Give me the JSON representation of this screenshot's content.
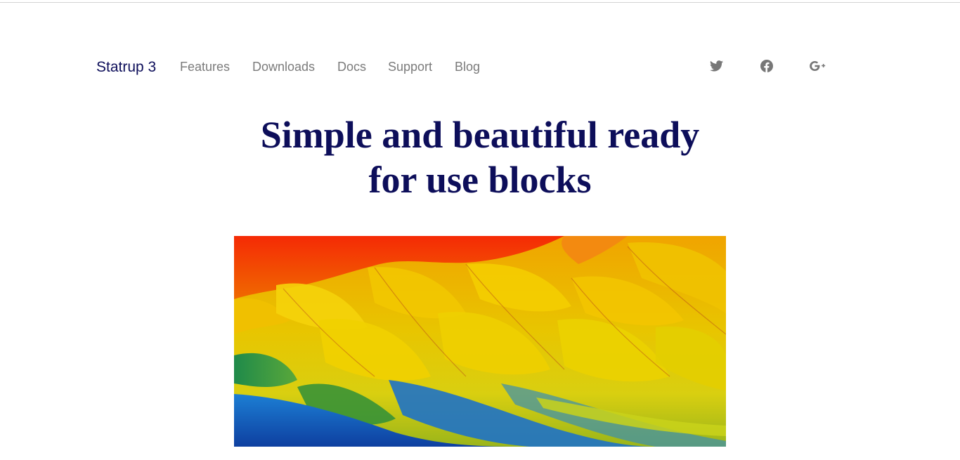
{
  "nav": {
    "brand": "Statrup 3",
    "links": [
      {
        "label": "Features"
      },
      {
        "label": "Downloads"
      },
      {
        "label": "Docs"
      },
      {
        "label": "Support"
      },
      {
        "label": "Blog"
      }
    ],
    "social": [
      {
        "icon": "twitter-icon"
      },
      {
        "icon": "facebook-icon"
      },
      {
        "icon": "google-plus-icon"
      }
    ]
  },
  "hero": {
    "title_line1": "Simple and beautiful ready",
    "title_line2": "for use blocks",
    "image": {
      "subject": "macaw-feathers"
    }
  },
  "colors": {
    "brand": "#0d0e5a",
    "nav_link": "#7b7b7b",
    "icon": "#777777",
    "top_rule": "#d4d4d4"
  }
}
